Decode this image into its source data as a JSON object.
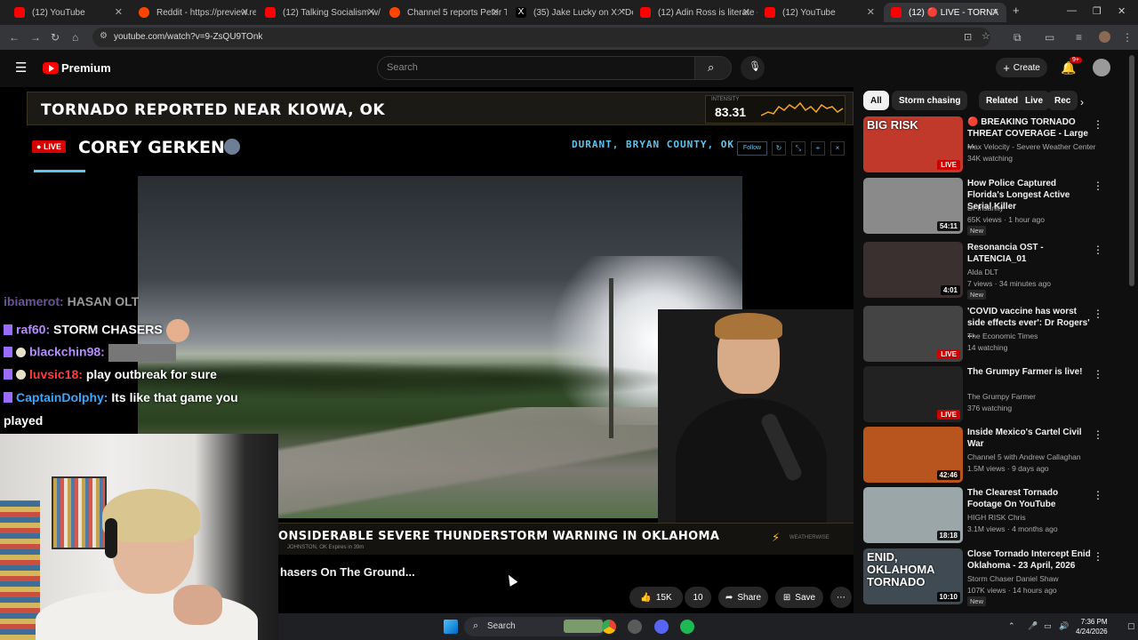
{
  "browser": {
    "tabs": [
      {
        "title": "(12) YouTube",
        "color": "#ff0000"
      },
      {
        "title": "Reddit - https://preview.re",
        "color": "#ff4500"
      },
      {
        "title": "(12) Talking Socialism w/ D",
        "color": "#ff0000"
      },
      {
        "title": "Channel 5 reports Peter Th",
        "color": "#ff4500"
      },
      {
        "title": "(35) Jake Lucky on X: \"Dev",
        "color": "#ffffff"
      },
      {
        "title": "(12) Adin Ross is literate -",
        "color": "#ff0000"
      },
      {
        "title": "(12) YouTube",
        "color": "#ff0000"
      },
      {
        "title": "(12) 🔴 LIVE - TORNA",
        "color": "#ff0000"
      }
    ],
    "new_tab": "+",
    "url": "youtube.com/watch?v=9-ZsQU9TOnk"
  },
  "youtube": {
    "brand": "Premium",
    "search_placeholder": "Search",
    "create_label": "Create",
    "notif_count": "9+"
  },
  "player": {
    "headline": "TORNADO REPORTED NEAR KIOWA, OK",
    "gauge_label": "INTENSITY",
    "gauge_value": "83.31",
    "live_label": "LIVE",
    "streamer": "COREY GERKEN",
    "location": "DURANT, BRYAN COUNTY, OK",
    "follow_label": "Follow",
    "bottom_headline": "ONSIDERABLE SEVERE THUNDERSTORM WARNING IN OKLAHOMA",
    "bottom_sub": "JOHNSTON, OK  Expires in 39m",
    "bottom_brand": "WEATHERWISE"
  },
  "chat": [
    {
      "user": "ibiamerot:",
      "msg": "HASAN OLT"
    },
    {
      "user": "raf60:",
      "msg": "STORM CHASERS"
    },
    {
      "user": "blackchin98:",
      "msg": ""
    },
    {
      "user": "luvsic18:",
      "msg": "play outbreak for sure"
    },
    {
      "user": "CaptainDolphy:",
      "msg": "Its like that game you"
    },
    {
      "user": "",
      "msg": "played"
    }
  ],
  "video": {
    "title": "hasers On The Ground...",
    "likes": "15K",
    "dislike_count": "10",
    "share_label": "Share",
    "save_label": "Save"
  },
  "sidebar": {
    "chips": [
      "All",
      "Storm chasing",
      "Related",
      "Live",
      "Rec"
    ],
    "recs": [
      {
        "title": "🔴 BREAKING TORNADO THREAT COVERAGE - Large ...",
        "channel": "Max Velocity - Severe Weather Center",
        "meta": "34K watching",
        "badge": "LIVE",
        "new": "",
        "thumb_text": "BIG RISK",
        "bg": "#c0392b"
      },
      {
        "title": "How Police Captured Florida's Longest Active Serial Killer",
        "channel": "Dr Insanity",
        "meta": "65K views · 1 hour ago",
        "badge": "54:11",
        "new": "New",
        "thumb_text": "",
        "bg": "#8a8a8a"
      },
      {
        "title": "Resonancia OST - LATENCIA_01",
        "channel": "Alda DLT",
        "meta": "7 views · 34 minutes ago",
        "badge": "4:01",
        "new": "New",
        "thumb_text": "",
        "bg": "#3a3030"
      },
      {
        "title": "'COVID vaccine has worst side effects ever': Dr Rogers' ...",
        "channel": "The Economic Times",
        "meta": "14 watching",
        "badge": "LIVE",
        "new": "",
        "thumb_text": "",
        "bg": "#444"
      },
      {
        "title": "The Grumpy Farmer is live!",
        "channel": "The Grumpy Farmer",
        "meta": "376 watching",
        "badge": "LIVE",
        "new": "",
        "thumb_text": "",
        "bg": "#222"
      },
      {
        "title": "Inside Mexico's Cartel Civil War",
        "channel": "Channel 5 with Andrew Callaghan",
        "meta": "1.5M views · 9 days ago",
        "badge": "42:46",
        "new": "",
        "thumb_text": "",
        "bg": "#b8541d"
      },
      {
        "title": "The Clearest Tornado Footage On YouTube",
        "channel": "HIGH RISK Chris",
        "meta": "3.1M views · 4 months ago",
        "badge": "18:18",
        "new": "",
        "thumb_text": "",
        "bg": "#9aa6a8"
      },
      {
        "title": "Close Tornado Intercept Enid Oklahoma - 23 April, 2026",
        "channel": "Storm Chaser Daniel Shaw",
        "meta": "107K views · 14 hours ago",
        "badge": "10:10",
        "new": "New",
        "thumb_text": "ENID, OKLAHOMA TORNADO",
        "bg": "#3f4a52"
      }
    ]
  },
  "taskbar": {
    "search_label": "Search",
    "time": "7:36 PM",
    "date": "4/24/2026"
  }
}
